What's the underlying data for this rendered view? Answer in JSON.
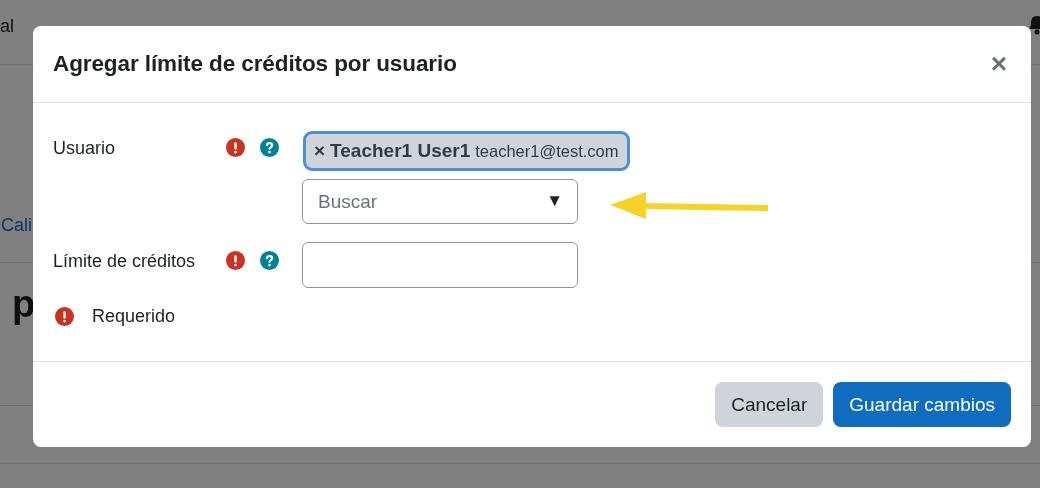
{
  "background": {
    "nav": [
      {
        "label": "al"
      }
    ],
    "link": "Cali",
    "heading": "p"
  },
  "dialog": {
    "title": "Agregar límite de créditos por usuario",
    "close": "×",
    "fields": [
      {
        "kind": "autocomplete",
        "label": "Usuario",
        "required": true,
        "help": true,
        "selection": [
          {
            "remove": "×",
            "name": "Teacher1 User1",
            "email": "teacher1@test.com"
          }
        ],
        "placeholder": "Buscar",
        "caret": "▼"
      },
      {
        "kind": "text",
        "label": "Límite de créditos",
        "required": true,
        "help": true
      }
    ],
    "legend": "Requerido",
    "buttons": [
      {
        "label": "Cancelar",
        "kind": "secondary"
      },
      {
        "label": "Guardar cambios",
        "kind": "primary"
      }
    ]
  }
}
